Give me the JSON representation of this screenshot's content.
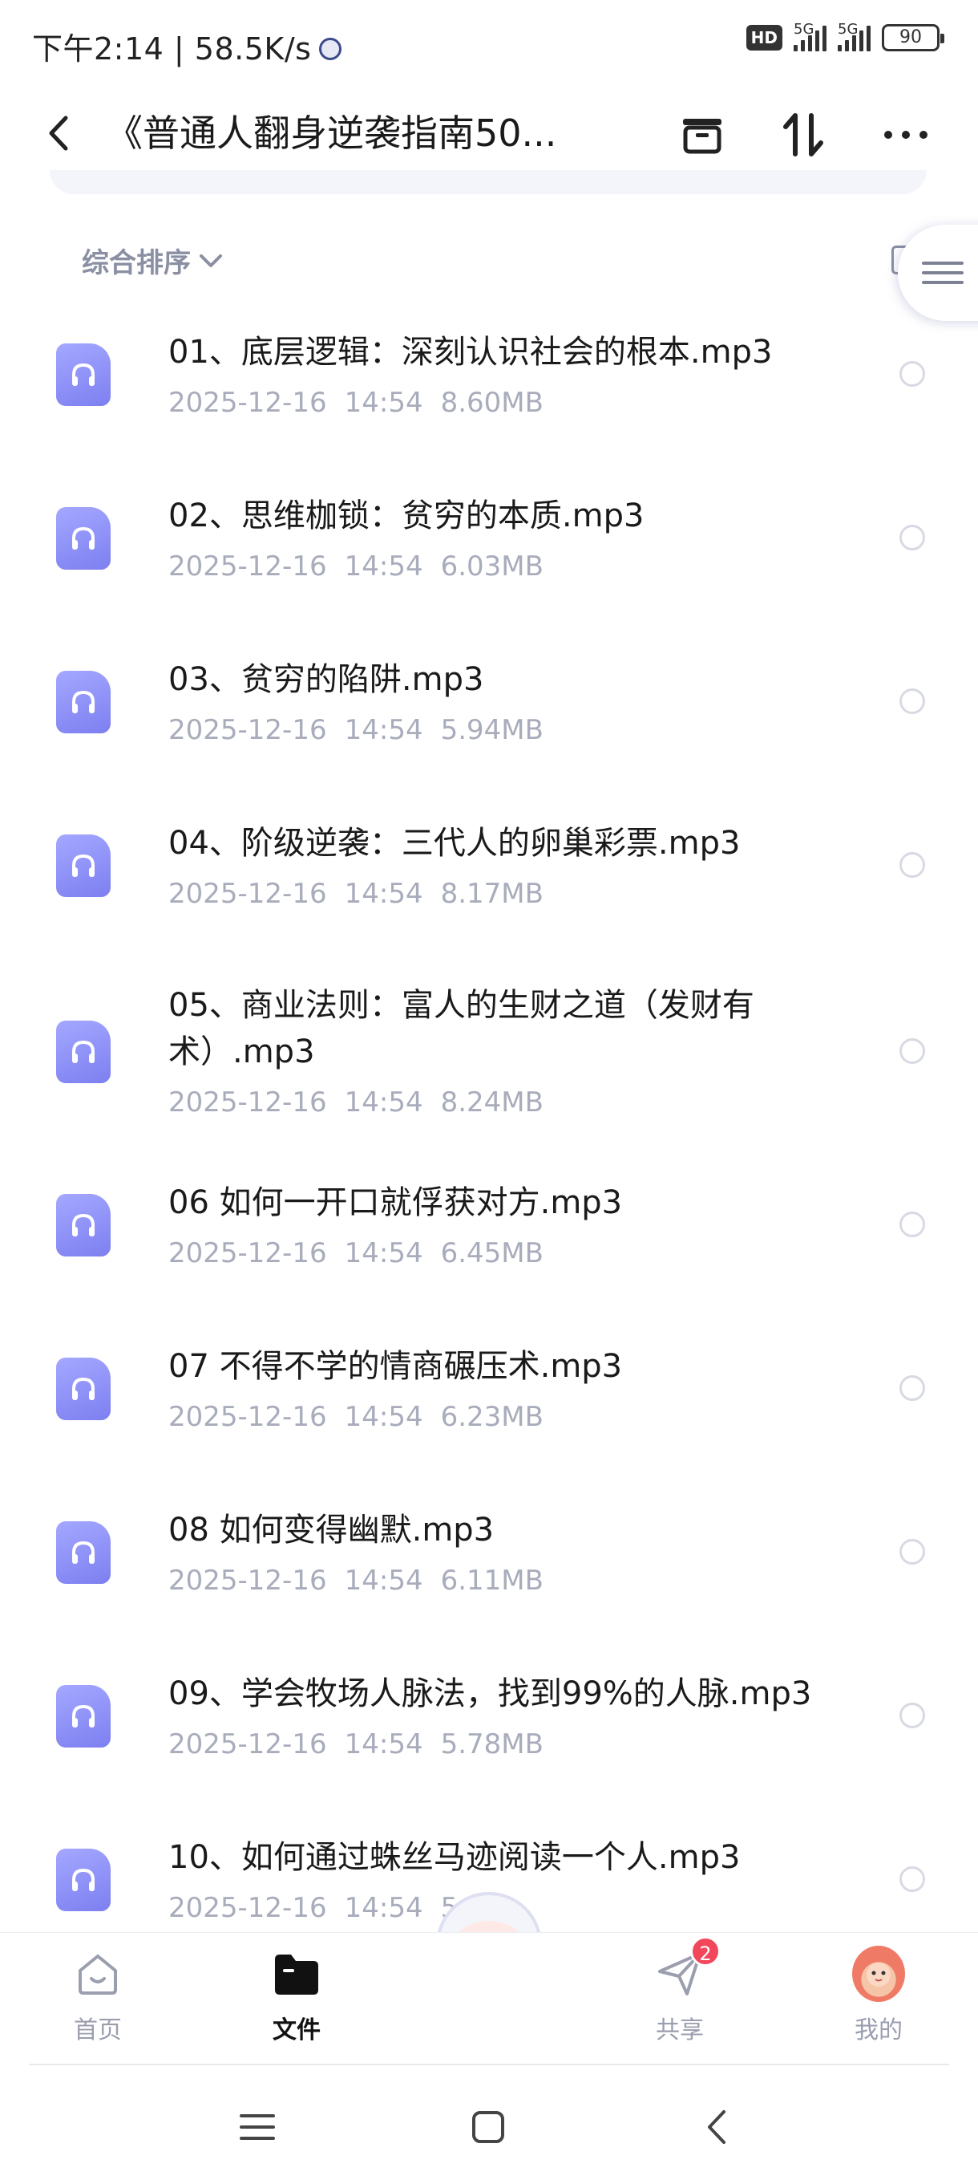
{
  "status_bar": {
    "time": "下午2:14 | 58.5K/s",
    "hd": "HD",
    "signal_1": "5G",
    "signal_2": "5G",
    "battery": "90"
  },
  "header": {
    "title": "《普通人翻身逆袭指南50...",
    "back_icon": "chevron-left-icon",
    "archive_icon": "archive-box-icon",
    "sort_icon": "sort-arrows-icon",
    "more_icon": "more-dots-icon"
  },
  "sort": {
    "label": "综合排序"
  },
  "files": [
    {
      "name": "01、底层逻辑：深刻认识社会的根本.mp3",
      "date": "2025-12-16",
      "time": "14:54",
      "size": "8.60MB"
    },
    {
      "name": "02、思维枷锁：贫穷的本质.mp3",
      "date": "2025-12-16",
      "time": "14:54",
      "size": "6.03MB"
    },
    {
      "name": "03、贫穷的陷阱.mp3",
      "date": "2025-12-16",
      "time": "14:54",
      "size": "5.94MB"
    },
    {
      "name": "04、阶级逆袭：三代人的卵巢彩票.mp3",
      "date": "2025-12-16",
      "time": "14:54",
      "size": "8.17MB"
    },
    {
      "name": "05、商业法则：富人的生财之道（发财有术）.mp3",
      "date": "2025-12-16",
      "time": "14:54",
      "size": "8.24MB"
    },
    {
      "name": "06 如何一开口就俘获对方.mp3",
      "date": "2025-12-16",
      "time": "14:54",
      "size": "6.45MB"
    },
    {
      "name": "07 不得不学的情商碾压术.mp3",
      "date": "2025-12-16",
      "time": "14:54",
      "size": "6.23MB"
    },
    {
      "name": "08 如何变得幽默.mp3",
      "date": "2025-12-16",
      "time": "14:54",
      "size": "6.11MB"
    },
    {
      "name": "09、学会牧场人脉法，找到99%的人脉.mp3",
      "date": "2025-12-16",
      "time": "14:54",
      "size": "5.78MB"
    },
    {
      "name": "10、如何通过蛛丝马迹阅读一个人.mp3",
      "date": "2025-12-16",
      "time": "14:54",
      "size": "5"
    }
  ],
  "bottom_nav": {
    "home": "首页",
    "files": "文件",
    "share": "共享",
    "share_badge": "2",
    "mine": "我的"
  },
  "colors": {
    "accent": "#8a8cf5",
    "meta_text": "#a8acbb",
    "badge": "#f2465a"
  }
}
